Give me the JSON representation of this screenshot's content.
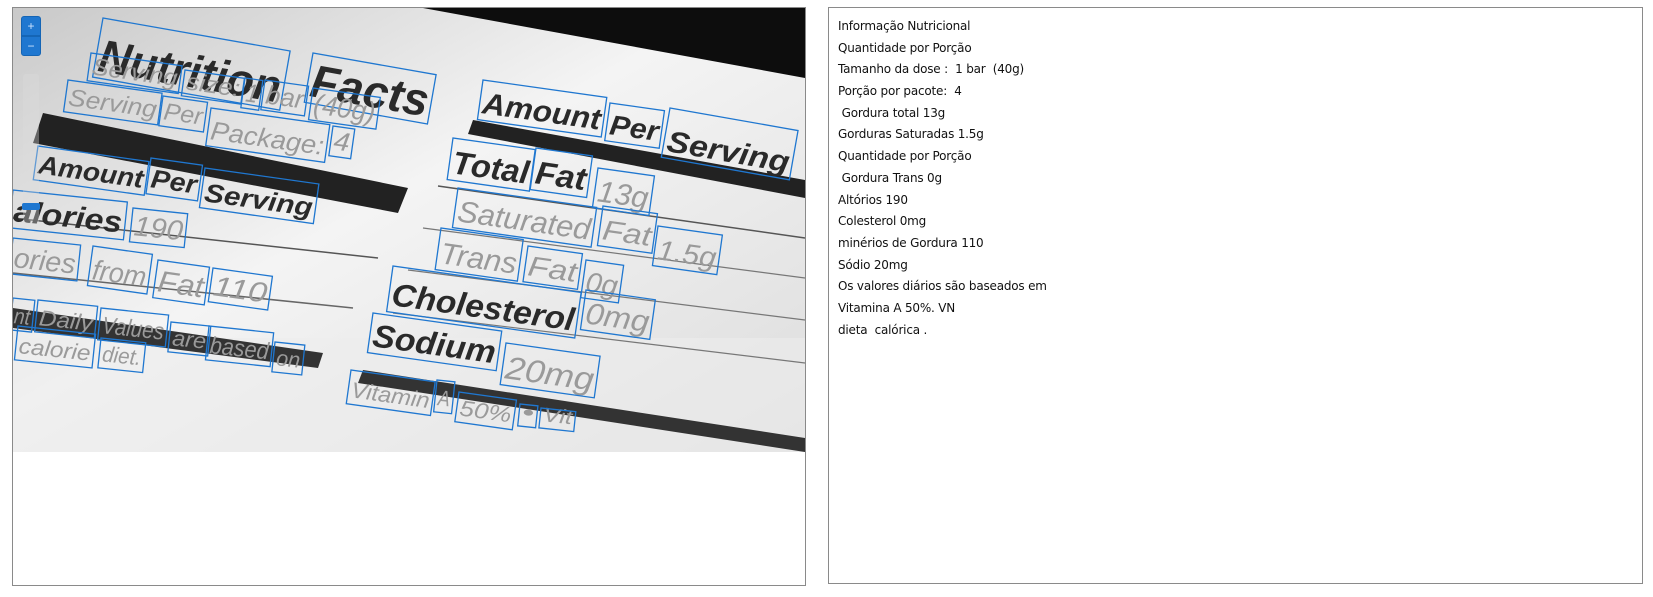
{
  "viewer": {
    "zoom_in_symbol": "+",
    "zoom_out_symbol": "−",
    "zoom_level": 0.1,
    "accent_color": "#1f77d0",
    "box_color": "#1f77d0"
  },
  "ocr": {
    "lines": [
      "Informação Nutricional",
      "Quantidade por Porção",
      "Tamanho da dose :  1 bar  (40g)",
      "Porção por pacote:  4",
      " Gordura total 13g",
      "Gorduras Saturadas 1.5g",
      "Quantidade por Porção",
      " Gordura Trans 0g",
      "Altórios 190",
      "Colesterol 0mg",
      "minérios de Gordura 110",
      "Sódio 20mg",
      "Os valores diários são baseados em",
      "Vitamina A 50%. VN",
      "dieta  calórica ."
    ]
  },
  "photo": {
    "words": [
      {
        "text": "Nutrition"
      },
      {
        "text": "Facts"
      },
      {
        "text": "Serving"
      },
      {
        "text": "size:"
      },
      {
        "text": "1"
      },
      {
        "text": "bar"
      },
      {
        "text": "(40g)"
      },
      {
        "text": "Serving"
      },
      {
        "text": "Per"
      },
      {
        "text": "Package:"
      },
      {
        "text": "4"
      },
      {
        "text": "Amount"
      },
      {
        "text": "Per"
      },
      {
        "text": "Serving"
      },
      {
        "text": "alories"
      },
      {
        "text": "190"
      },
      {
        "text": "ories"
      },
      {
        "text": "from"
      },
      {
        "text": "Fat"
      },
      {
        "text": "110"
      },
      {
        "text": "nt"
      },
      {
        "text": "Daily"
      },
      {
        "text": "Values"
      },
      {
        "text": "are"
      },
      {
        "text": "based"
      },
      {
        "text": "on"
      },
      {
        "text": "calorie"
      },
      {
        "text": "diet."
      },
      {
        "text": "Amount"
      },
      {
        "text": "Per"
      },
      {
        "text": "Serving"
      },
      {
        "text": "Total"
      },
      {
        "text": "Fat"
      },
      {
        "text": "13g"
      },
      {
        "text": "Saturated"
      },
      {
        "text": "Fat"
      },
      {
        "text": "1.5g"
      },
      {
        "text": "Trans"
      },
      {
        "text": "Fat"
      },
      {
        "text": "0g"
      },
      {
        "text": "Cholesterol"
      },
      {
        "text": "0mg"
      },
      {
        "text": "Sodium"
      },
      {
        "text": "20mg"
      },
      {
        "text": "Vitamin"
      },
      {
        "text": "A"
      },
      {
        "text": "50%"
      },
      {
        "text": "•"
      },
      {
        "text": "Vit"
      }
    ]
  }
}
